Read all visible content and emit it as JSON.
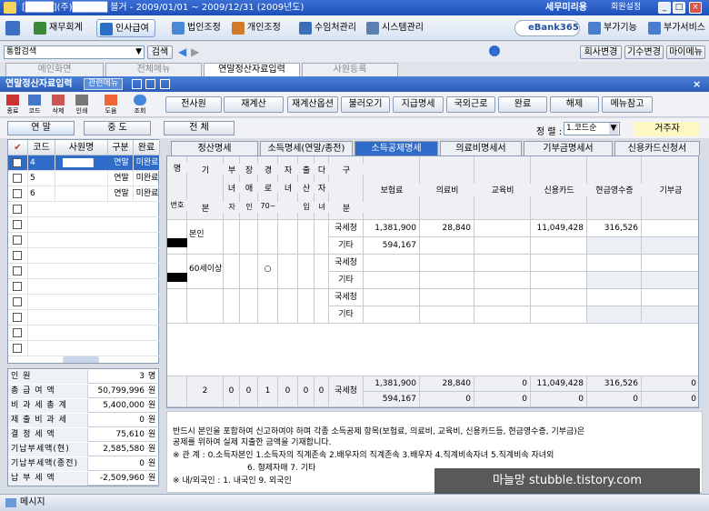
{
  "window": {
    "title": "[████](주)█████ 블거 - 2009/01/01 ~ 2009/12/31 (2009년도)",
    "app_name": "세무미리용",
    "green_label": "회원설정"
  },
  "menu": {
    "items": [
      "재무회계",
      "인사급여",
      "법인조정",
      "개인조정",
      "수임처관리",
      "시스템관리"
    ],
    "active": "인사급여",
    "brand": "eBank365",
    "right_items": [
      "부가기능",
      "부가서비스"
    ]
  },
  "search": {
    "select": "통합검색",
    "button": "검색",
    "right_buttons": [
      "회사변경",
      "기수변경",
      "마이메뉴"
    ]
  },
  "pagetabs": [
    "메인화면",
    "전체메뉴",
    "연말정산자료입력",
    "사원등록"
  ],
  "active_pagetab": "연말정산자료입력",
  "window_header": {
    "title": "연말정산자료입력",
    "mode": "관련메뉴"
  },
  "toolbar": {
    "icons": [
      "종료",
      "코드",
      "삭제",
      "인쇄",
      "도움",
      "조회"
    ],
    "buttons": [
      "전사원",
      "재계산",
      "재계산옵션",
      "불러오기",
      "지급명세",
      "국외근로",
      "완료",
      "해제",
      "메뉴참고"
    ]
  },
  "filter": {
    "tabs": [
      "연 말",
      "중 도",
      "전 체"
    ],
    "sort_label": "정 렬 :",
    "sort_value": "1.코드순",
    "residency": "거주자"
  },
  "employee_grid": {
    "headers": [
      "코드",
      "사원명",
      "구분",
      "완료"
    ],
    "rows": [
      {
        "code": "4",
        "name": "",
        "type": "연말",
        "done": "미완료"
      },
      {
        "code": "5",
        "name": "",
        "type": "연말",
        "done": "미완료"
      },
      {
        "code": "6",
        "name": "",
        "type": "연말",
        "done": "미완료"
      }
    ]
  },
  "summary": [
    {
      "k": "인 원",
      "v": "3",
      "u": "명"
    },
    {
      "k": "총 급 여 액",
      "v": "50,799,996",
      "u": "원"
    },
    {
      "k": "비 과 세 총 계",
      "v": "5,400,000",
      "u": "원"
    },
    {
      "k": "제 출 비 과 세",
      "v": "0",
      "u": "원"
    },
    {
      "k": "결 정 세 액",
      "v": "75,610",
      "u": "원"
    },
    {
      "k": "기납부세액(현)",
      "v": "2,585,580",
      "u": "원"
    },
    {
      "k": "기납부세액(종전)",
      "v": "0",
      "u": "원"
    },
    {
      "k": "납 부 세 액",
      "v": "-2,509,960",
      "u": "원"
    }
  ],
  "right_tabs": [
    "정산명세",
    "소득명세(연말/종전)",
    "소득공제명세",
    "의료비명세서",
    "기부금명세서",
    "신용카드신청서"
  ],
  "active_right_tab": "소득공제명세",
  "deduction_grid": {
    "headers": {
      "name": "명",
      "rel": "기",
      "rel2": "본",
      "ded": [
        "부",
        "장",
        "경",
        "자",
        "출",
        "다"
      ],
      "ded2": [
        "녀",
        "애",
        "로",
        "녀",
        "산",
        "자"
      ],
      "ded3": [
        "자",
        "인",
        "70~",
        "",
        "입",
        "녀"
      ],
      "gubun": "구",
      "gubun2": "분",
      "cols": [
        "보험료",
        "의료비",
        "교육비",
        "신용카드",
        "현금영수증",
        "기부금"
      ],
      "num_label": "번호"
    },
    "rows": [
      {
        "rel": "본인",
        "src": [
          "국세청",
          "기타"
        ],
        "ins": [
          "1,381,900",
          "594,167"
        ],
        "med": [
          "28,840",
          ""
        ],
        "edu": [
          "",
          ""
        ],
        "card": [
          "11,049,428",
          ""
        ],
        "cash": [
          "316,526",
          ""
        ],
        "don": [
          "",
          ""
        ],
        "mark": ""
      },
      {
        "rel": "60세이상",
        "src": [
          "국세청",
          "기타"
        ],
        "ins": [
          "",
          ""
        ],
        "med": [
          "",
          ""
        ],
        "edu": [
          "",
          ""
        ],
        "card": [
          "",
          ""
        ],
        "cash": [
          "",
          ""
        ],
        "don": [
          "",
          ""
        ],
        "mark": "○"
      },
      {
        "rel": "",
        "src": [
          "국세청",
          "기타"
        ],
        "ins": [
          "",
          ""
        ],
        "med": [
          "",
          ""
        ],
        "edu": [
          "",
          ""
        ],
        "card": [
          "",
          ""
        ],
        "cash": [
          "",
          ""
        ],
        "don": [
          "",
          ""
        ],
        "mark": ""
      }
    ],
    "total": {
      "count": "2",
      "flags": [
        "0",
        "0",
        "1",
        "0",
        "0",
        "0"
      ],
      "src": "국세청",
      "ins": [
        "1,381,900",
        "594,167"
      ],
      "med": [
        "28,840",
        "0"
      ],
      "edu": [
        "0",
        "0"
      ],
      "card": [
        "11,049,428",
        "0"
      ],
      "cash": [
        "316,526",
        "0"
      ],
      "don": [
        "0",
        "0"
      ]
    }
  },
  "notes": [
    "반드시 본인을 포함하여 신고하여야 하며 각종 소득공제 항목(보험료, 의료비, 교육비, 신용카드등, 현금영수증, 기부금)은",
    "공제를 위하여 실제 지출한 금액을 기재합니다.",
    "※ 관 계 : 0.소득자본인 1.소득자의 직계존속 2.배우자의 직계존속 3.배우자 4.직계비속자녀 5.직계비속 자녀외",
    "6. 형제자매 7. 기타",
    "※ 내/외국인 : 1. 내국인 9. 외국인"
  ],
  "watermark": "마늘망 stubble.tistory.com",
  "status": {
    "label": "메시지"
  }
}
